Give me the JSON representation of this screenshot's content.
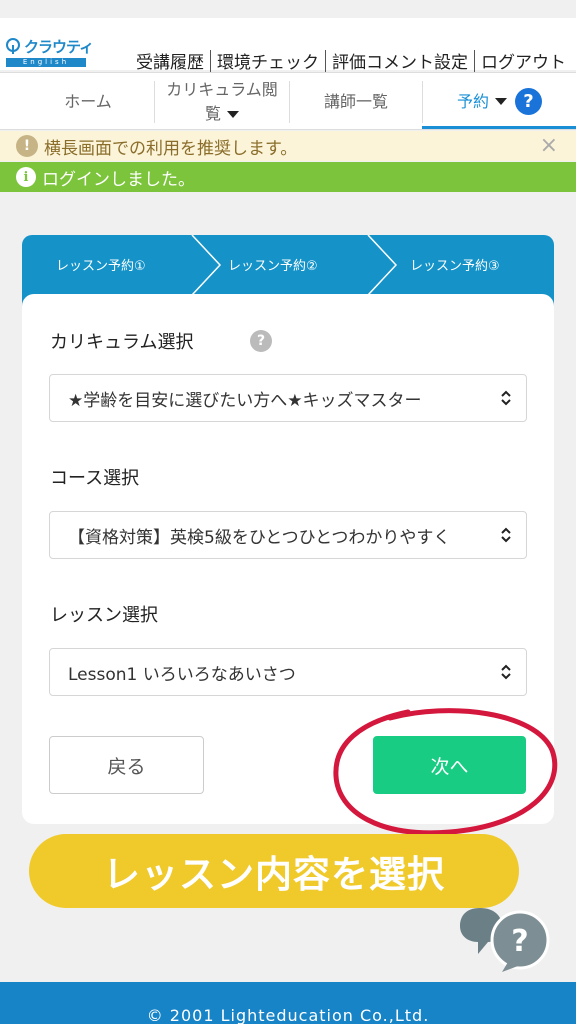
{
  "header": {
    "logo": {
      "brand": "クラウティ",
      "sub": "English"
    },
    "top_links": [
      "受講履歴",
      "環境チェック",
      "評価コメント設定",
      "ログアウト"
    ]
  },
  "nav": {
    "home": "ホーム",
    "curriculum_line1": "カリキュラム閲",
    "curriculum_line2": "覧",
    "teachers": "講師一覧",
    "reserve": "予約",
    "help_icon": "?"
  },
  "alerts": {
    "notice": "横長画面での利用を推奨します。",
    "notice_icon": "!",
    "close": "×",
    "success": "ログインしました。",
    "success_icon": "i"
  },
  "steps": [
    "レッスン予約①",
    "レッスン予約②",
    "レッスン予約③"
  ],
  "form": {
    "curriculum_label": "カリキュラム選択",
    "curriculum_help": "?",
    "curriculum_value": "★学齢を目安に選びたい方へ★キッズマスター",
    "course_label": "コース選択",
    "course_value": "【資格対策】英検5級をひとつひとつわかりやすく",
    "lesson_label": "レッスン選択",
    "lesson_value": "Lesson1 いろいろなあいさつ",
    "back_button": "戻る",
    "next_button": "次へ"
  },
  "callout": "レッスン内容を選択",
  "chat_icon": "?",
  "footer": "© 2001 Lighteducation Co.,Ltd.",
  "colors": {
    "primary": "#1593c9",
    "next_button": "#19cc84",
    "success": "#7cc43c",
    "callout": "#f0c92b",
    "annotation": "#d4173c"
  }
}
